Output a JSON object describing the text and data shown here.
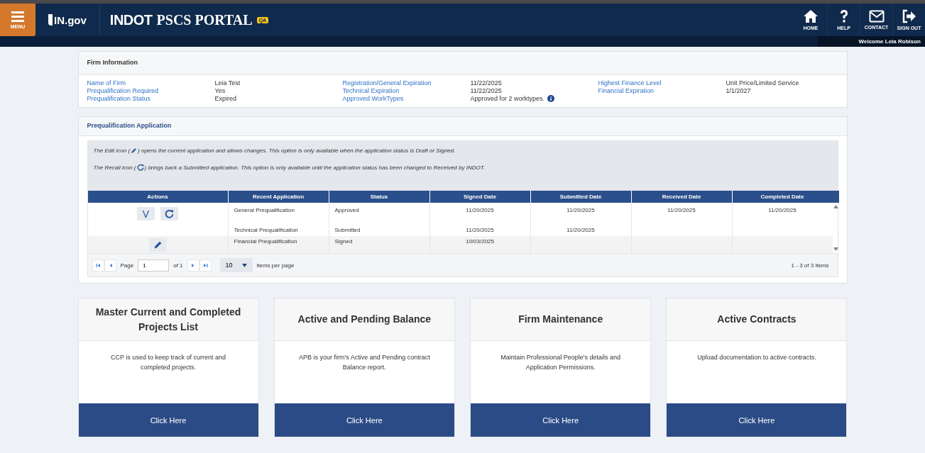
{
  "header": {
    "menu_label": "MENU",
    "logo": "IN.gov",
    "title_bold": "INDOT",
    "title": "PSCS PORTAL",
    "badge": "QA",
    "nav": [
      {
        "kind": "home",
        "label": "HOME"
      },
      {
        "kind": "help",
        "label": "HELP"
      },
      {
        "kind": "contact",
        "label": "CONTACT"
      },
      {
        "kind": "signout",
        "label": "SIGN OUT"
      }
    ],
    "welcome": "Welcome Leia Robison"
  },
  "firm_info": {
    "title": "Firm Information",
    "fields": [
      {
        "label": "Name of Firm",
        "value": "Leia Test",
        "info": false
      },
      {
        "label": "Registration/General Expiration",
        "value": "11/22/2025",
        "info": false
      },
      {
        "label": "Highest Finance Level",
        "value": "Unit Price/Limited Service",
        "info": false
      },
      {
        "label": "Prequalification Required",
        "value": "Yes",
        "info": false
      },
      {
        "label": "Technical Expiration",
        "value": "11/22/2025",
        "info": false
      },
      {
        "label": "Financial Expiration",
        "value": "1/1/2027",
        "info": false
      },
      {
        "label": "Prequalification Status",
        "value": "Expired",
        "info": false
      },
      {
        "label": "Approved WorkTypes",
        "value": "Approved for 2 worktypes.",
        "info": true
      }
    ]
  },
  "prequal": {
    "title": "Prequalification Application",
    "notes": [
      {
        "before": "The Edit icon (",
        "after": ") opens the current application and allows changes. This option is only available when the application status is Draft or Signed."
      },
      {
        "before": "The Recall icon (",
        "after": ") brings back a Submitted application. This option is only available until the application status has been changed to Received by INDOT."
      }
    ],
    "columns": [
      "Actions",
      "Recent Application",
      "Status",
      "Signed Date",
      "Submitted Date",
      "Received Date",
      "Completed Date"
    ],
    "rows": [
      {
        "actions": [
          {
            "kind": "text",
            "label": "V"
          },
          {
            "kind": "recall"
          }
        ],
        "cells": [
          "",
          "General Prequalification",
          "Approved",
          "11/20/2025",
          "11/20/2025",
          "11/20/2025",
          "11/20/2025"
        ]
      },
      {
        "actions": [],
        "cells": [
          "",
          "Technical Prequalification",
          "Submitted",
          "11/20/2025",
          "11/20/2025",
          "",
          ""
        ]
      },
      {
        "actions": [
          {
            "kind": "edit"
          }
        ],
        "cells": [
          "",
          "Financial Prequalification",
          "Signed",
          "10/03/2025",
          "",
          "",
          ""
        ]
      }
    ],
    "pager": {
      "page_label": "Page",
      "page": "1",
      "of": "of 1",
      "page_size": "10",
      "per_page": "items per page",
      "summary": "1 - 3 of 3 items"
    }
  },
  "cards": [
    {
      "title": "Master Current and Completed Projects List",
      "text": "CCP is used to keep track of current and completed projects.",
      "button": "Click Here"
    },
    {
      "title": "Active and Pending Balance",
      "text": "APB is your firm's Active and Pending contract Balance report.",
      "button": "Click Here"
    },
    {
      "title": "Firm Maintenance",
      "text": "Maintain Professional People's details and Application Permissions.",
      "button": "Click Here"
    },
    {
      "title": "Active Contracts",
      "text": "Upload documentation to active contracts.",
      "button": "Click Here"
    }
  ]
}
